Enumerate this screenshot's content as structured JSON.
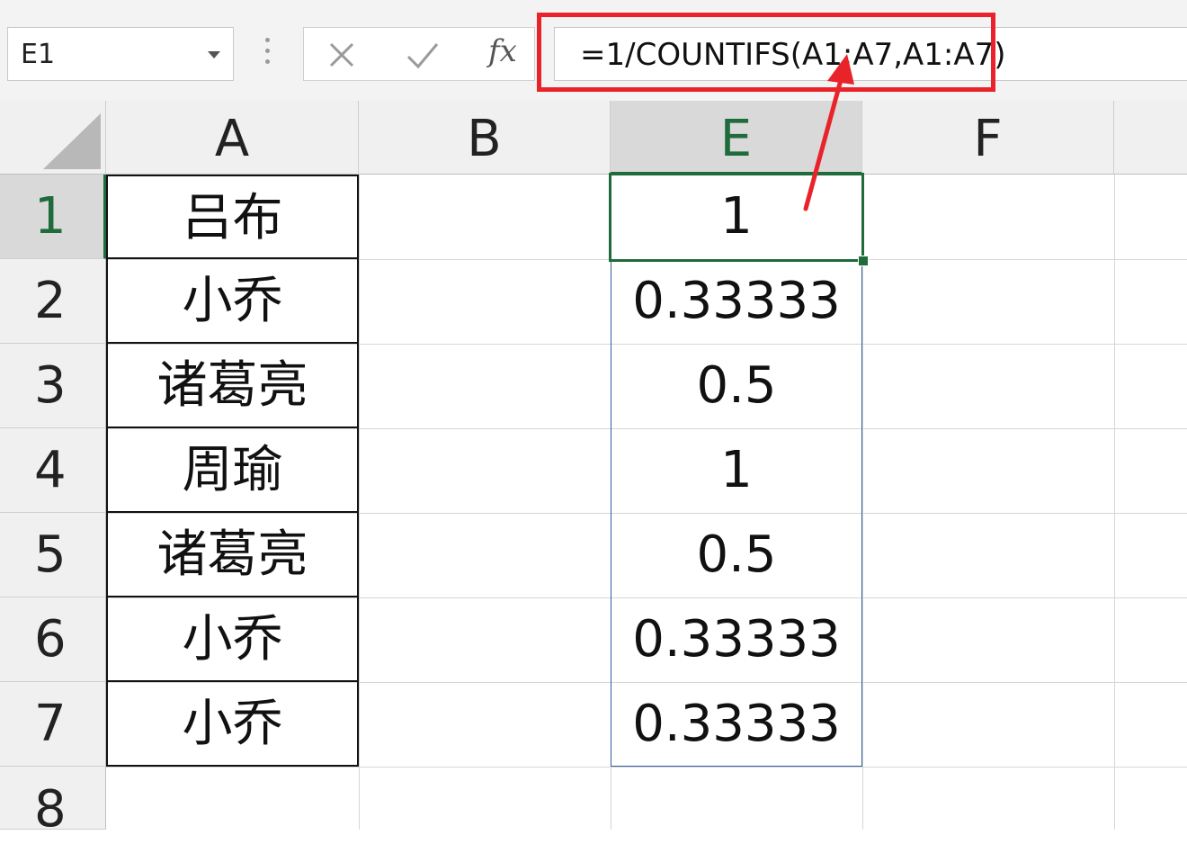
{
  "formula_bar": {
    "name_box": "E1",
    "formula": "=1/COUNTIFS(A1:A7,A1:A7)",
    "icons": {
      "cancel": "x-icon",
      "enter": "check-icon",
      "function": "fx-icon"
    },
    "fx_label": "fx"
  },
  "columns": [
    "A",
    "B",
    "E",
    "F"
  ],
  "rows": [
    "1",
    "2",
    "3",
    "4",
    "5",
    "6",
    "7",
    "8"
  ],
  "column_a": [
    "吕布",
    "小乔",
    "诸葛亮",
    "周瑜",
    "诸葛亮",
    "小乔",
    "小乔"
  ],
  "column_e": [
    "1",
    "0.33333",
    "0.5",
    "1",
    "0.5",
    "0.33333",
    "0.33333"
  ],
  "colors": {
    "highlight": "#e8232a",
    "selection": "#1f6b3b",
    "range_border": "#2e5e9e"
  }
}
